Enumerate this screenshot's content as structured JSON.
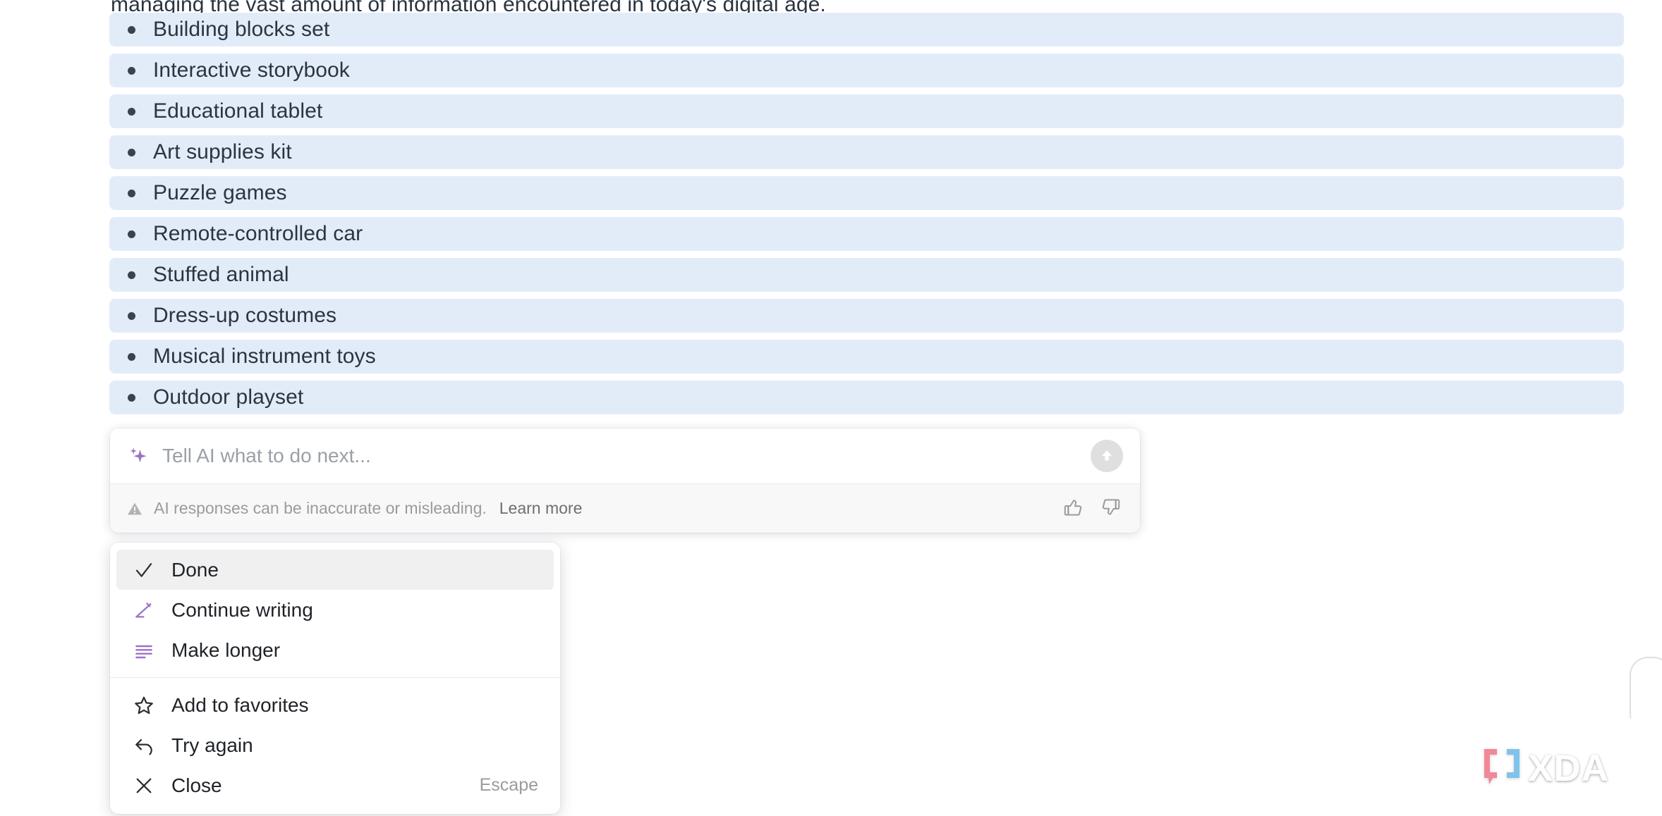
{
  "document": {
    "cutoff_paragraph": "managing the vast amount of information encountered in today's digital age."
  },
  "ai_list": {
    "items": [
      {
        "text": "Building blocks set"
      },
      {
        "text": "Interactive storybook"
      },
      {
        "text": "Educational tablet"
      },
      {
        "text": "Art supplies kit"
      },
      {
        "text": "Puzzle games"
      },
      {
        "text": "Remote-controlled car"
      },
      {
        "text": "Stuffed animal"
      },
      {
        "text": "Dress-up costumes"
      },
      {
        "text": "Musical instrument toys"
      },
      {
        "text": "Outdoor playset"
      }
    ],
    "highlight_color": "#e2ecf9",
    "bullet_color": "#3a424e",
    "text_color": "#2b3440"
  },
  "ai_panel": {
    "sparkle_icon": "sparkle-icon",
    "input_value": "",
    "input_placeholder": "Tell AI what to do next...",
    "send_icon": "arrow-up-icon",
    "warning_icon": "warning-triangle-icon",
    "disclaimer": "AI responses can be inaccurate or misleading.",
    "learn_more": "Learn more",
    "thumbs_up_icon": "thumbs-up-icon",
    "thumbs_down_icon": "thumbs-down-icon",
    "accent_color": "#9b72c9"
  },
  "ai_menu": {
    "groups": [
      {
        "items": [
          {
            "label": "Done",
            "icon": "check-icon",
            "selected": true,
            "shortcut": ""
          },
          {
            "label": "Continue writing",
            "icon": "pencil-line-icon",
            "selected": false,
            "shortcut": ""
          },
          {
            "label": "Make longer",
            "icon": "text-lines-icon",
            "selected": false,
            "shortcut": ""
          }
        ]
      },
      {
        "items": [
          {
            "label": "Add to favorites",
            "icon": "star-icon",
            "selected": false,
            "shortcut": ""
          },
          {
            "label": "Try again",
            "icon": "undo-arrow-icon",
            "selected": false,
            "shortcut": ""
          },
          {
            "label": "Close",
            "icon": "close-x-icon",
            "selected": false,
            "shortcut": "Escape"
          }
        ]
      }
    ]
  },
  "watermark": {
    "text": "XDA",
    "bracket_left_color": "#f08898",
    "bracket_right_color": "#7fc2ea"
  }
}
